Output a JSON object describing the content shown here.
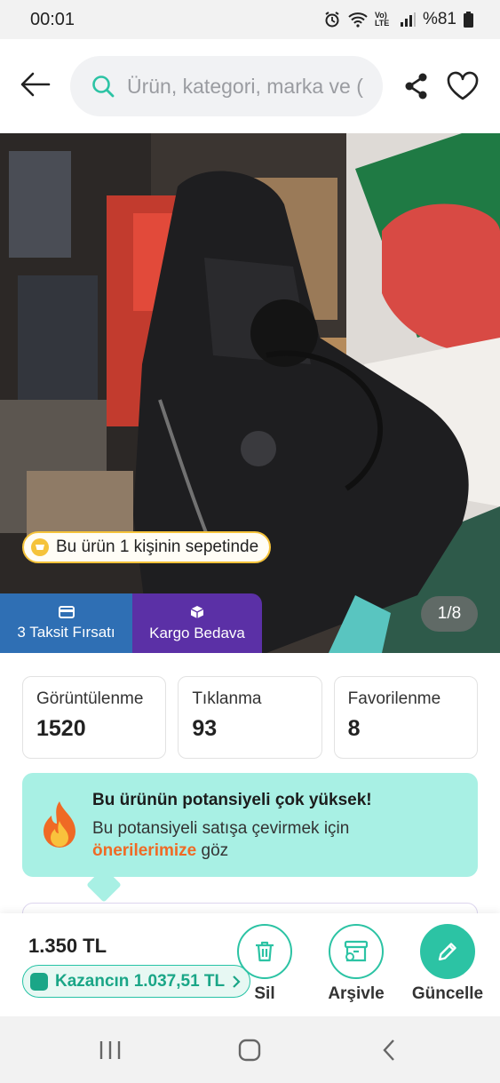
{
  "status_bar": {
    "time": "00:01",
    "network_label": "Vo) LTE",
    "battery": "%81"
  },
  "search": {
    "placeholder": "Ürün, kategori, marka ve (",
    "icon": "search-icon"
  },
  "gallery": {
    "basket_text": "Bu ürün 1 kişinin sepetinde",
    "counter": "1/8",
    "badges": [
      {
        "label": "3 Taksit Fırsatı",
        "icon": "card-icon",
        "color": "#2f6fb4"
      },
      {
        "label": "Kargo Bedava",
        "icon": "box-icon",
        "color": "#5b30a6"
      }
    ]
  },
  "stats": [
    {
      "label": "Görüntülenme",
      "value": "1520"
    },
    {
      "label": "Tıklanma",
      "value": "93"
    },
    {
      "label": "Favorilenme",
      "value": "8"
    }
  ],
  "potential": {
    "title": "Bu ürünün potansiyeli çok yüksek!",
    "text_before": "Bu potansiyeli satışa çevirmek için",
    "link": "önerilerimize",
    "text_after": "göz",
    "icon": "fire-icon"
  },
  "bottom_bar": {
    "price": "1.350 TL",
    "earnings": "Kazancın 1.037,51 TL",
    "actions": [
      {
        "label": "Sil",
        "icon": "trash-icon"
      },
      {
        "label": "Arşivle",
        "icon": "archive-icon"
      },
      {
        "label": "Güncelle",
        "icon": "pencil-icon"
      }
    ]
  },
  "colors": {
    "accent": "#2cc3a4",
    "banner": "#a8f0e4",
    "highlight": "#ef6a25"
  }
}
